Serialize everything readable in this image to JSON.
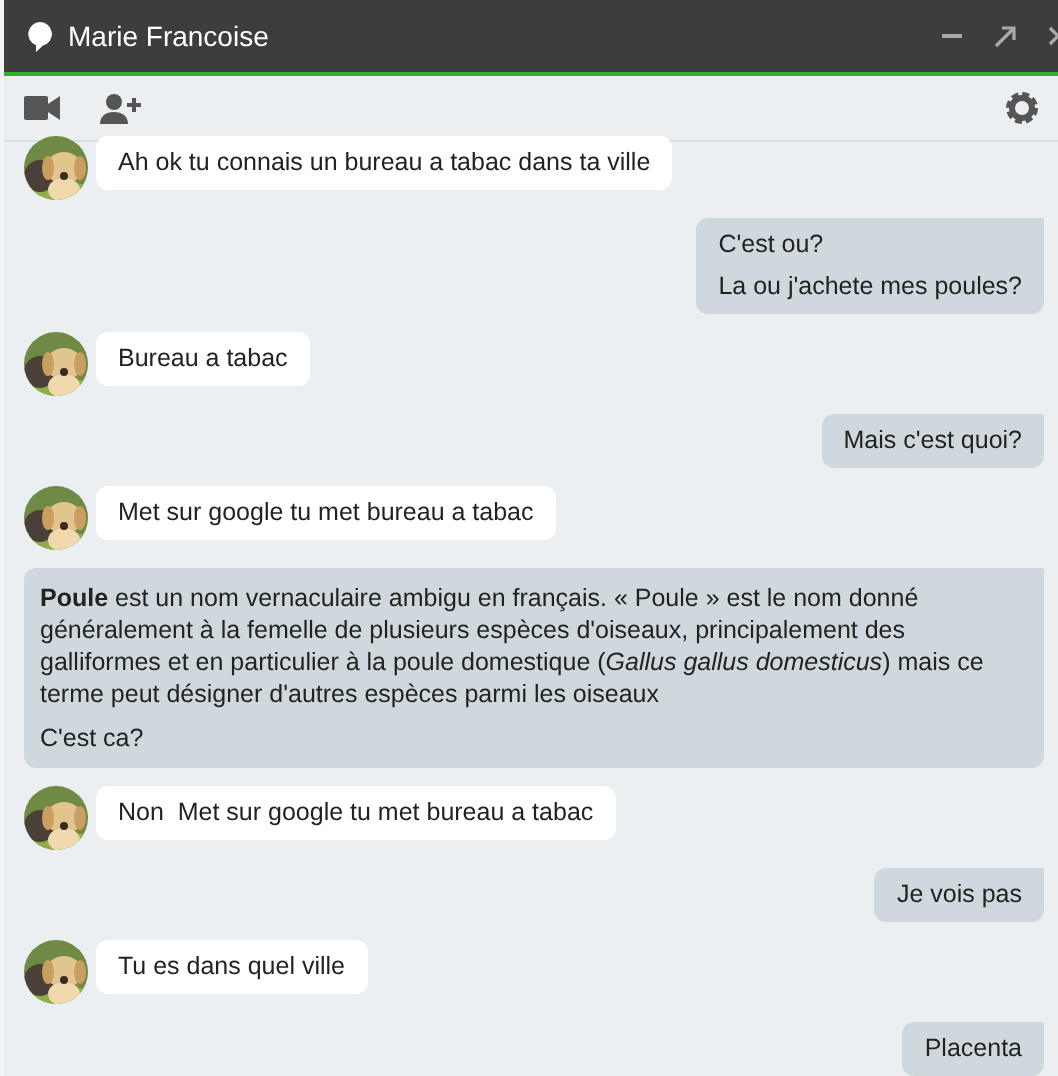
{
  "window": {
    "title": "Marie Francoise"
  },
  "messages": [
    {
      "kind": "incoming",
      "lines": [
        "Ah ok tu connais un bureau a tabac dans ta ville"
      ]
    },
    {
      "kind": "outgoing",
      "lines": [
        "C'est ou?",
        "La ou j'achete mes poules?"
      ]
    },
    {
      "kind": "incoming",
      "lines": [
        "Bureau a tabac"
      ]
    },
    {
      "kind": "outgoing",
      "lines": [
        "Mais c'est quoi?"
      ]
    },
    {
      "kind": "incoming",
      "lines": [
        "Met sur google tu met bureau a tabac"
      ]
    },
    {
      "kind": "outgoing",
      "lines": [
        "**Poule** est un nom vernaculaire ambigu en français. « Poule » est le nom donné généralement à la femelle de plusieurs espèces d'oiseaux, principalement des galliformes et en particulier à la poule domestique (*Gallus gallus domesticus*) mais ce terme peut désigner d'autres espèces parmi les oiseaux",
        "C'est ca?"
      ]
    },
    {
      "kind": "incoming",
      "lines": [
        "Non  Met sur google tu met bureau a tabac"
      ]
    },
    {
      "kind": "outgoing",
      "lines": [
        "Je vois pas"
      ]
    },
    {
      "kind": "incoming",
      "lines": [
        "Tu es dans quel ville"
      ]
    },
    {
      "kind": "outgoing",
      "lines": [
        "Placenta"
      ]
    }
  ]
}
